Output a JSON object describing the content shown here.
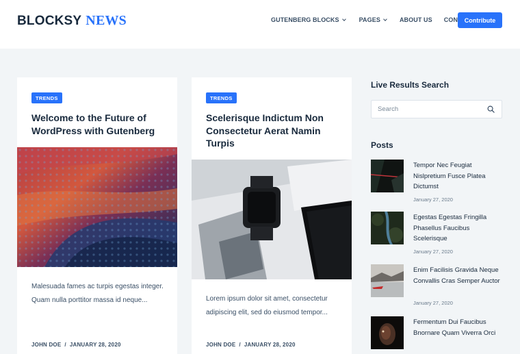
{
  "site": {
    "logo_part1": "BLOCKSY",
    "logo_part2": "NEWS",
    "brand_color": "#2872fa"
  },
  "nav": {
    "items": [
      {
        "label": "GUTENBERG BLOCKS",
        "has_dropdown": true
      },
      {
        "label": "PAGES",
        "has_dropdown": true
      },
      {
        "label": "ABOUT US",
        "has_dropdown": false
      },
      {
        "label": "CONTACT",
        "has_dropdown": false
      }
    ],
    "cta_label": "Contribute"
  },
  "posts": [
    {
      "badge": "TRENDS",
      "title": "Welcome to the Future of WordPress with Gutenberg",
      "excerpt": "Malesuada fames ac turpis egestas integer. Quam nulla porttitor massa id neque...",
      "author": "JOHN DOE",
      "separator": "/",
      "date": "JANUARY 28, 2020"
    },
    {
      "badge": "TRENDS",
      "title": "Scelerisque Indictum Non Consectetur Aerat Namin Turpis",
      "excerpt": "Lorem ipsum dolor sit amet, consectetur adipiscing elit, sed do eiusmod tempor...",
      "author": "JOHN DOE",
      "separator": "/",
      "date": "JANUARY 28, 2020"
    }
  ],
  "sidebar": {
    "search_heading": "Live Results Search",
    "search_placeholder": "Search",
    "posts_heading": "Posts",
    "recent": [
      {
        "title": "Tempor Nec Feugiat Nislpretium Fusce Platea Dictumst",
        "date": "January 27, 2020"
      },
      {
        "title": "Egestas Egestas Fringilla Phasellus Faucibus Scelerisque",
        "date": "January 27, 2020"
      },
      {
        "title": "Enim Facilisis Gravida Neque Convallis Cras Semper Auctor",
        "date": "January 27, 2020"
      },
      {
        "title": "Fermentum Dui Faucibus Bnornare Quam Viverra Orci",
        "date": ""
      }
    ]
  }
}
